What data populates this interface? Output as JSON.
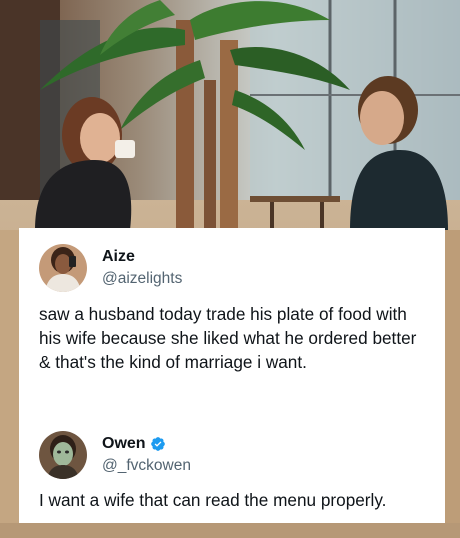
{
  "tweets": [
    {
      "display_name": "Aize",
      "handle": "@aizelights",
      "text": "saw a husband today trade his plate of food with his wife because she liked what he ordered better & that's the kind of marriage i want.",
      "verified": false
    },
    {
      "display_name": "Owen",
      "handle": "@_fvckowen",
      "text": "I want a wife that can read the menu properly.",
      "verified": true
    }
  ],
  "colors": {
    "text_primary": "#0f1419",
    "text_secondary": "#536471",
    "verified_blue": "#1d9bf0",
    "card_bg": "#ffffff"
  },
  "icons": {
    "verified": "verified-badge-icon"
  }
}
